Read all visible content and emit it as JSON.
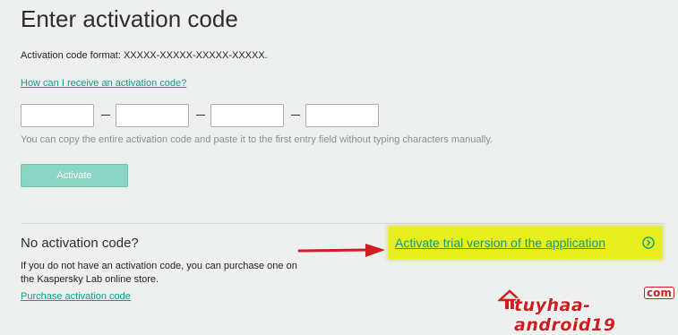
{
  "page": {
    "title": "Enter activation code",
    "format_text": "Activation code format: XXXXX-XXXXX-XXXXX-XXXXX.",
    "how_link": "How can I receive an activation code?",
    "hint": "You can copy the entire activation code and paste it to the first entry field without typing characters manually.",
    "activate_label": "Activate",
    "code_fields": [
      "",
      "",
      "",
      ""
    ]
  },
  "no_code": {
    "heading": "No activation code?",
    "description": "If you do not have an activation code, you can purchase one on the Kaspersky Lab online store.",
    "purchase_link": "Purchase activation code"
  },
  "trial": {
    "label": "Activate trial version of the application",
    "icon": "chevron-right-circle-icon"
  },
  "watermark": {
    "text": "tuyhaa-android19",
    "badge": "com",
    "icon": "house-logo-icon"
  },
  "colors": {
    "link": "#139b82",
    "highlight": "#e7ef1c",
    "arrow": "#d01e1e",
    "button": "#8ad5c3"
  }
}
